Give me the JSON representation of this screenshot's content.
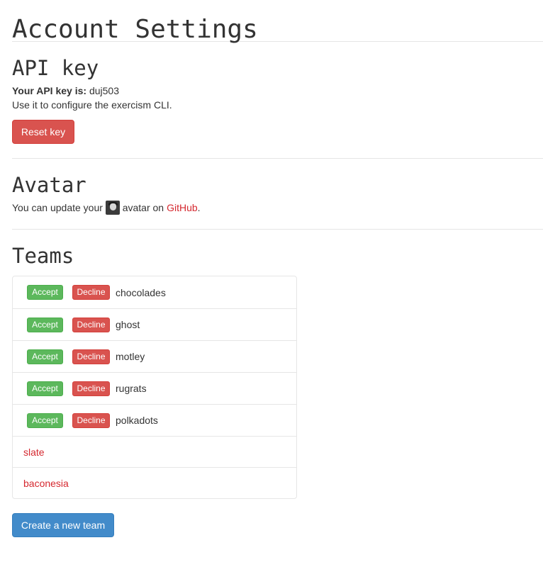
{
  "page": {
    "title": "Account Settings"
  },
  "api": {
    "title": "API key",
    "key_label": "Your API key is:",
    "key_value": "duj503",
    "help_text": "Use it to configure the exercism CLI.",
    "reset_label": "Reset key"
  },
  "avatar": {
    "title": "Avatar",
    "text_before": "You can update your",
    "text_middle": "avatar on",
    "link_text": "GitHub",
    "text_after": "."
  },
  "teams": {
    "title": "Teams",
    "accept_label": "Accept",
    "decline_label": "Decline",
    "pending": [
      {
        "name": "chocolades"
      },
      {
        "name": "ghost"
      },
      {
        "name": "motley"
      },
      {
        "name": "rugrats"
      },
      {
        "name": "polkadots"
      }
    ],
    "member": [
      {
        "name": "slate"
      },
      {
        "name": "baconesia"
      }
    ],
    "create_label": "Create a new team"
  },
  "colors": {
    "danger": "#d9534f",
    "success": "#5cb85c",
    "primary": "#428bca",
    "link": "#d5282f"
  }
}
